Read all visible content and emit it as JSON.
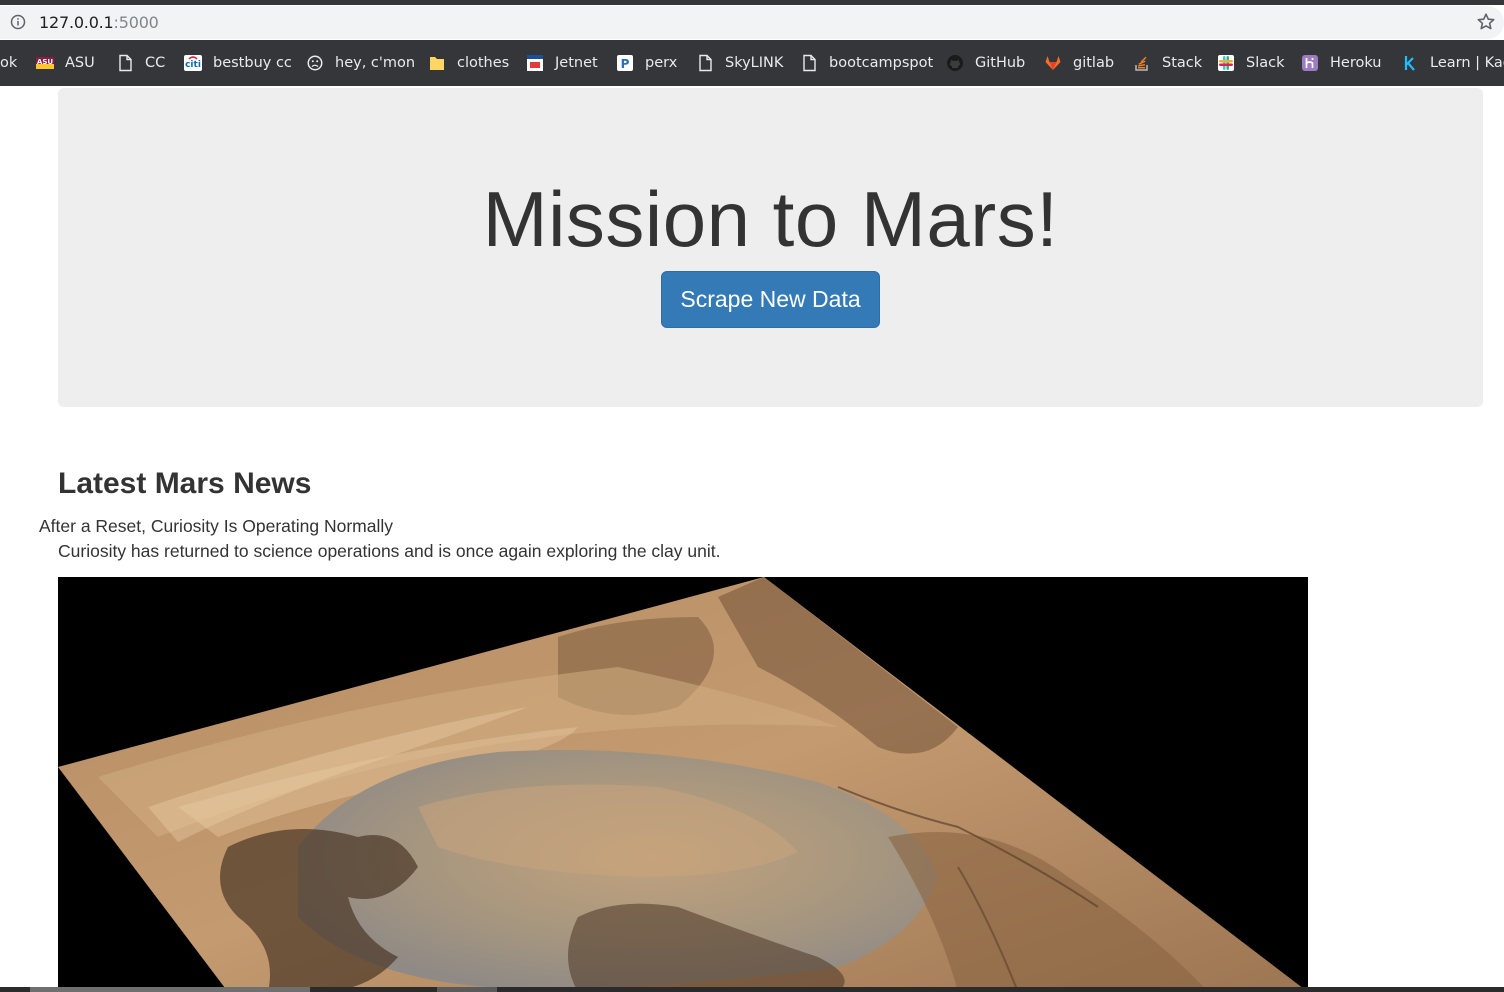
{
  "browser": {
    "address_bar": {
      "url_host": "127.0.0.1",
      "url_port": ":5000",
      "info_icon": "info-circle-icon",
      "bookmark_icon": "star-outline-icon"
    },
    "bookmarks": [
      {
        "label": "ok",
        "icon": "none"
      },
      {
        "label": "ASU",
        "icon": "asu-logo-icon"
      },
      {
        "label": "CC",
        "icon": "page-icon"
      },
      {
        "label": "bestbuy cc",
        "icon": "citi-logo-icon"
      },
      {
        "label": "hey, c'mon",
        "icon": "sad-face-icon"
      },
      {
        "label": "clothes",
        "icon": "folder-icon"
      },
      {
        "label": "Jetnet",
        "icon": "jetnet-icon"
      },
      {
        "label": "perx",
        "icon": "perx-icon"
      },
      {
        "label": "SkyLINK",
        "icon": "page-icon"
      },
      {
        "label": "bootcampspot",
        "icon": "page-icon"
      },
      {
        "label": "GitHub",
        "icon": "github-icon"
      },
      {
        "label": "gitlab",
        "icon": "gitlab-icon"
      },
      {
        "label": "Stack",
        "icon": "stackoverflow-icon"
      },
      {
        "label": "Slack",
        "icon": "slack-icon"
      },
      {
        "label": "Heroku",
        "icon": "heroku-icon"
      },
      {
        "label": "Learn | Kag",
        "icon": "kaggle-icon"
      }
    ]
  },
  "page": {
    "jumbotron": {
      "title": "Mission to Mars!",
      "button_label": "Scrape New Data"
    },
    "news": {
      "heading": "Latest Mars News",
      "title": "After a Reset, Curiosity Is Operating Normally",
      "paragraph": "Curiosity has returned to science operations and is once again exploring the clay unit."
    }
  },
  "colors": {
    "chrome_dark": "#35363a",
    "jumbotron_bg": "#eeeeee",
    "button_primary": "#337ab7",
    "text": "#333333"
  }
}
